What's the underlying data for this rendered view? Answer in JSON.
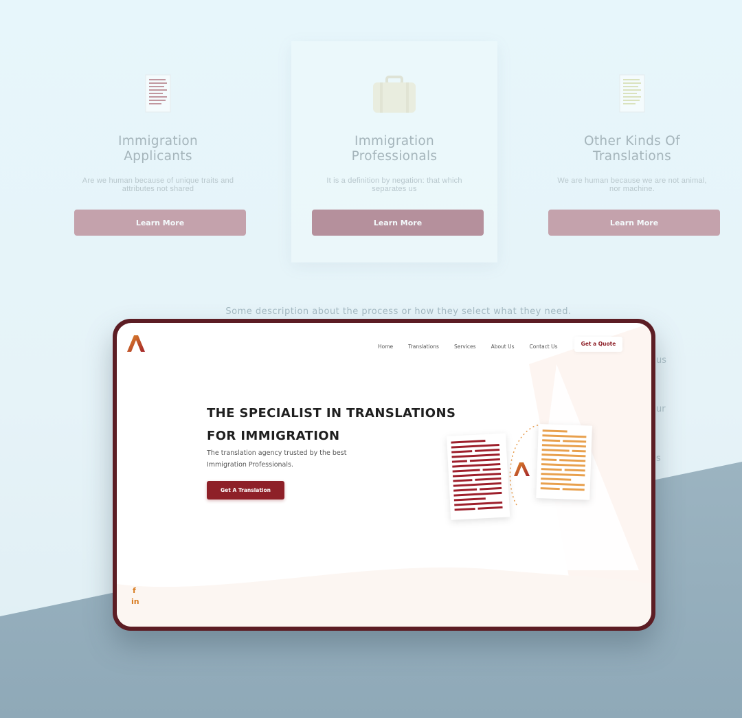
{
  "background": {
    "cards": [
      {
        "title_line1": "Immigration",
        "title_line2": "Applicants",
        "text_line1": "Are we human because of unique traits and",
        "text_line2": "attributes not shared",
        "button": "Learn More",
        "icon": "document-icon"
      },
      {
        "title_line1": "Immigration",
        "title_line2": "Professionals",
        "text_line1": "It is a definition by negation: that which",
        "text_line2": "separates us",
        "button": "Learn More",
        "icon": "briefcase-icon"
      },
      {
        "title_line1": "Other Kinds Of",
        "title_line2": "Translations",
        "text_line1": "We are human because we are not animal,",
        "text_line2": "nor machine.",
        "button": "Learn More",
        "icon": "document-icon"
      }
    ],
    "description": "Some description about the process or how they select what they need.",
    "ghost_fragments": [
      "us",
      "ur",
      "s"
    ]
  },
  "site": {
    "logo": "logo-icon",
    "nav": [
      "Home",
      "Translations",
      "Services",
      "About Us",
      "Contact Us"
    ],
    "quote_button": "Get a Quote",
    "hero_title_line1": "THE SPECIALIST IN TRANSLATIONS",
    "hero_title_line2": "FOR IMMIGRATION",
    "hero_sub_line1": "The translation agency trusted by the best",
    "hero_sub_line2": "Immigration Professionals.",
    "cta": "Get A Translation",
    "social": [
      "f",
      "in"
    ]
  },
  "colors": {
    "brand": "#8e2028",
    "accent": "#d77a1e",
    "device_frame": "#5c1d24"
  }
}
